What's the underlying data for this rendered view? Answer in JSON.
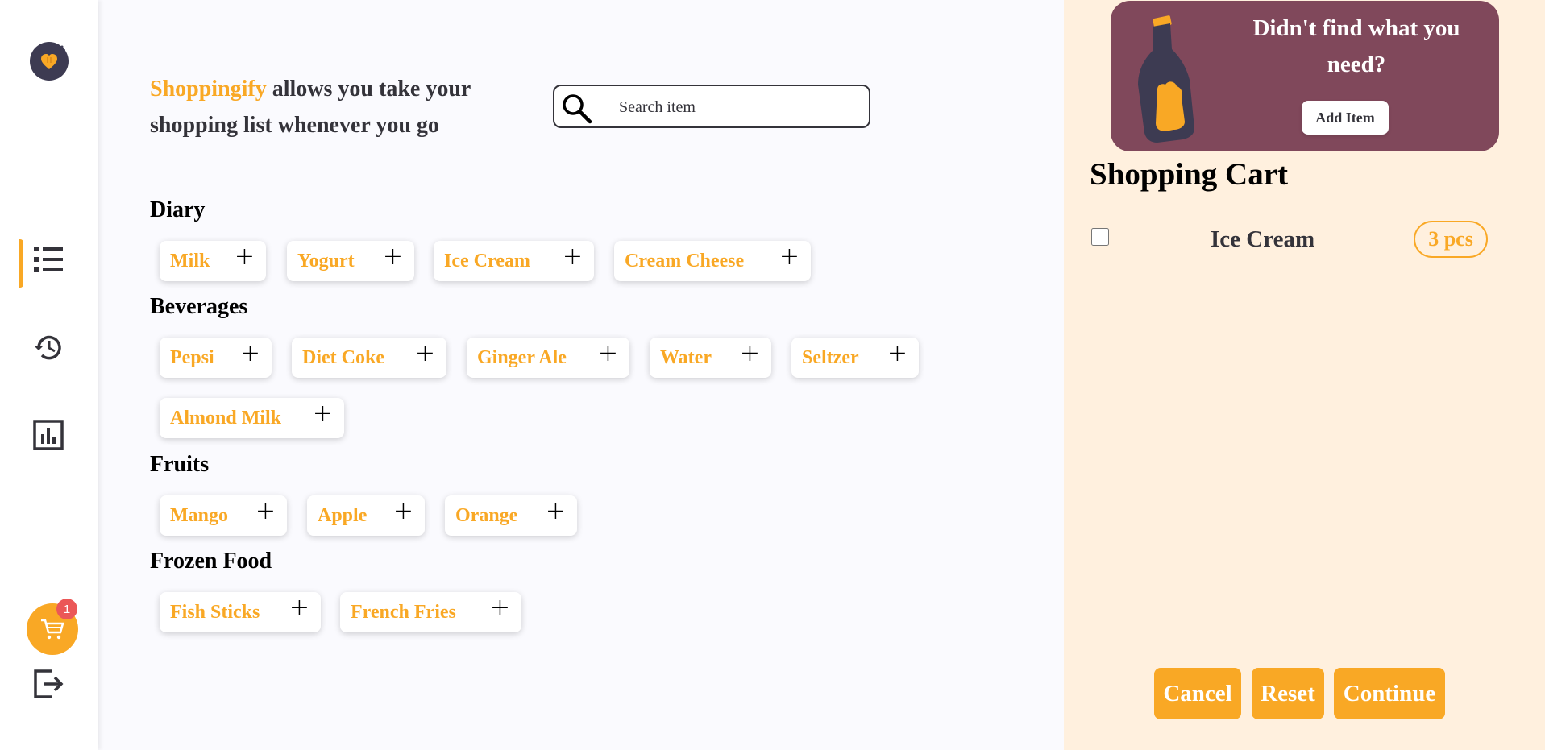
{
  "colors": {
    "accent": "#f9a825",
    "promo": "#80485b",
    "panel": "#fff0de",
    "badge": "#eb5757",
    "text": "#34333a"
  },
  "sidebar": {
    "logo": "shoppingify-logo",
    "items": [
      {
        "name": "items",
        "icon": "list-icon",
        "active": true
      },
      {
        "name": "history",
        "icon": "history-icon",
        "active": false
      },
      {
        "name": "statistics",
        "icon": "chart-icon",
        "active": false
      }
    ],
    "cart_badge": "1",
    "logout_icon": "logout-icon"
  },
  "header": {
    "brand": "Shoppingify",
    "tagline": " allows you take your shopping list whenever you go"
  },
  "search": {
    "placeholder": "Search item",
    "value": ""
  },
  "categories": [
    {
      "title": "Diary",
      "items": [
        "Milk",
        "Yogurt",
        "Ice Cream",
        "Cream Cheese"
      ]
    },
    {
      "title": "Beverages",
      "items": [
        "Pepsi",
        "Diet Coke",
        "Ginger Ale",
        "Water",
        "Seltzer",
        "Almond Milk"
      ]
    },
    {
      "title": "Fruits",
      "items": [
        "Mango",
        "Apple",
        "Orange"
      ]
    },
    {
      "title": "Frozen Food",
      "items": [
        "Fish Sticks",
        "French Fries"
      ]
    }
  ],
  "plus_symbol": "+",
  "promo": {
    "text": "Didn't find what you need?",
    "button": "Add Item"
  },
  "cart": {
    "title": "Shopping Cart",
    "items": [
      {
        "name": "Ice Cream",
        "qty": "3 pcs",
        "checked": false
      }
    ]
  },
  "actions": {
    "cancel": "Cancel",
    "reset": "Reset",
    "continue": "Continue"
  }
}
